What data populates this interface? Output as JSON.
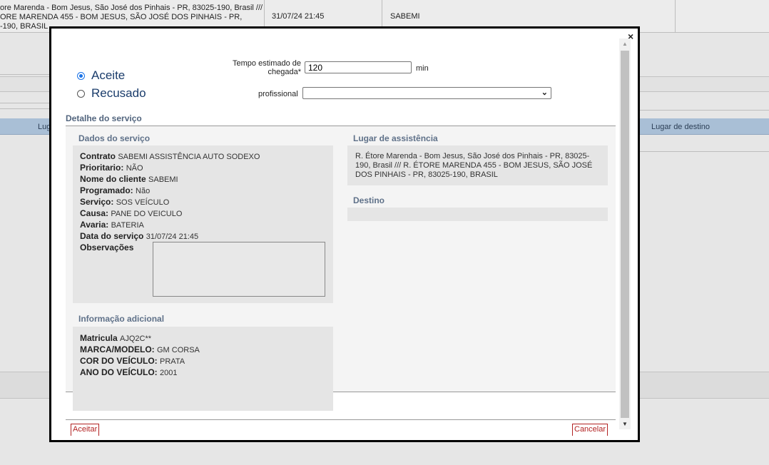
{
  "background": {
    "row": {
      "address": "ore Marenda - Bom Jesus, São José dos Pinhais - PR, 83025-190, Brasil ///\nORE MARENDA 455 - BOM JESUS, SÃO JOSÉ DOS PINHAIS - PR,\n-190, BRASIL",
      "date": "31/07/24 21:45",
      "client": "SABEMI"
    },
    "table_header": {
      "col_left": "Lug",
      "col_destino": "Lugar de destino"
    }
  },
  "modal": {
    "close": "×",
    "status_options": [
      {
        "label": "Aceite",
        "checked": true
      },
      {
        "label": "Recusado",
        "checked": false
      }
    ],
    "tempo": {
      "label": "Tempo estimado de chegada*",
      "value": "120",
      "unit": "min"
    },
    "profissional": {
      "label": "profissional",
      "value": ""
    },
    "detail_title": "Detalhe do serviço",
    "dados": {
      "title": "Dados do serviço",
      "fields": [
        {
          "label": "Contrato",
          "value": "SABEMI ASSISTÊNCIA AUTO SODEXO"
        },
        {
          "label": "Prioritario:",
          "value": "NÃO"
        },
        {
          "label": "Nome do cliente",
          "value": "SABEMI"
        },
        {
          "label": "Programado:",
          "value": "Não"
        },
        {
          "label": "Serviço:",
          "value": "SOS VEÍCULO"
        },
        {
          "label": "Causa:",
          "value": "PANE DO VEICULO"
        },
        {
          "label": "Avaria:",
          "value": "BATERIA"
        },
        {
          "label": "Data do serviço",
          "value": "31/07/24 21:45"
        }
      ],
      "observacoes_label": "Observações",
      "observacoes_value": ""
    },
    "info": {
      "title": "Informação adicional",
      "fields": [
        {
          "label": "Matricula",
          "value": "AJQ2C**"
        },
        {
          "label": "MARCA/MODELO:",
          "value": " GM CORSA"
        },
        {
          "label": "COR DO VEÍCULO:",
          "value": " PRATA"
        },
        {
          "label": "ANO DO VEÍCULO:",
          "value": " 2001"
        }
      ]
    },
    "lugar": {
      "title": "Lugar de assistência",
      "address": "R. Étore Marenda - Bom Jesus, São José dos Pinhais - PR, 83025-190, Brasil /// R. ÉTORE MARENDA 455 - BOM JESUS, SÃO JOSÉ DOS PINHAIS - PR, 83025-190, BRASIL"
    },
    "destino": {
      "title": "Destino",
      "value": ""
    },
    "buttons": {
      "accept": "Aceitar",
      "cancel": "Cancelar"
    }
  }
}
